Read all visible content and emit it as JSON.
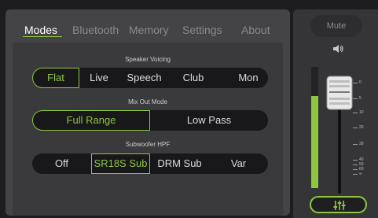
{
  "tabs": [
    {
      "label": "Modes",
      "active": true
    },
    {
      "label": "Bluetooth",
      "active": false
    },
    {
      "label": "Memory",
      "active": false
    },
    {
      "label": "Settings",
      "active": false
    },
    {
      "label": "About",
      "active": false
    }
  ],
  "speaker_voicing": {
    "label": "Speaker Voicing",
    "options": [
      "Flat",
      "Live",
      "Speech",
      "Club",
      "Mon"
    ],
    "selected": "Flat"
  },
  "mix_out_mode": {
    "label": "Mix Out Mode",
    "options": [
      "Full Range",
      "Low Pass"
    ],
    "selected": "Full Range"
  },
  "subwoofer_hpf": {
    "label": "Subwoofer HPF",
    "options": [
      "Off",
      "SR18S Sub",
      "DRM Sub",
      "Var"
    ],
    "selected": "SR18S Sub"
  },
  "mute_label": "Mute",
  "fader": {
    "scale": [
      "0",
      "5",
      "10",
      "20",
      "30",
      "40",
      "50",
      "60",
      "∞"
    ],
    "meter_level": 0.76
  },
  "colors": {
    "accent": "#8ec63f",
    "panel": "#444446",
    "segment_bg": "#18181a"
  },
  "icons": {
    "speaker": "speaker-volume-icon",
    "eq": "eq-sliders-icon"
  }
}
